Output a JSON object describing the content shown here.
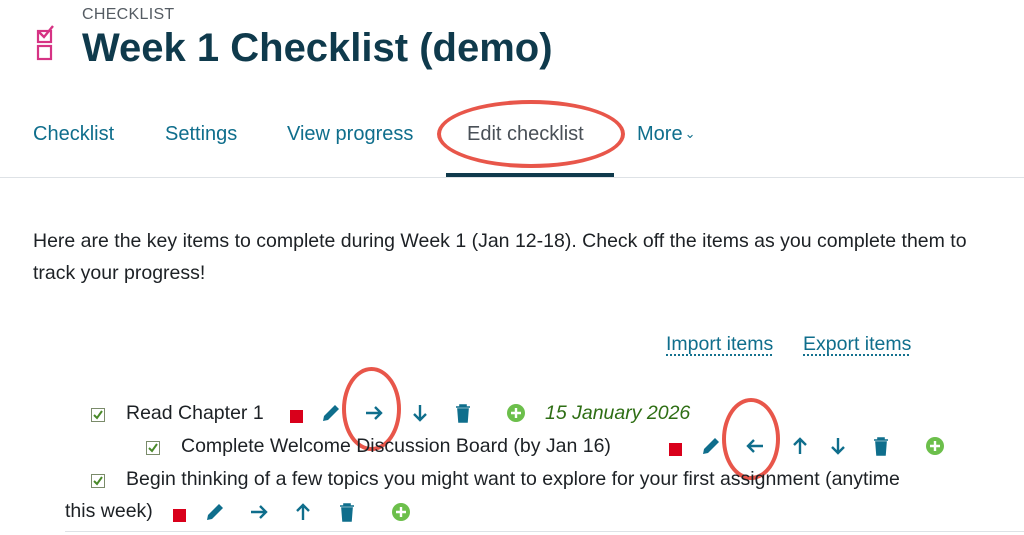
{
  "header": {
    "crumb": "CHECKLIST",
    "title": "Week 1 Checklist (demo)",
    "module_icon": "checklist-icon"
  },
  "tabs": [
    {
      "label": "Checklist"
    },
    {
      "label": "Settings"
    },
    {
      "label": "View progress"
    },
    {
      "label": "Edit checklist",
      "active": true
    },
    {
      "label": "More"
    }
  ],
  "intro": "Here are the key items to complete during Week 1 (Jan 12-18). Check off the items as you complete them to track your progress!",
  "actions": {
    "import": "Import items",
    "export": "Export items"
  },
  "items": [
    {
      "text": "Read Chapter 1",
      "indent": 0,
      "date": "15 January 2026"
    },
    {
      "text": "Complete Welcome Discussion Board (by Jan 16)",
      "indent": 1
    },
    {
      "text": "Begin thinking of a few topics you might want to explore for your first assignment (anytime",
      "text2": "this week)",
      "indent": 0
    }
  ],
  "colors": {
    "accent": "#0f6e8c",
    "title": "#0f3a4c",
    "required": "#d9001b",
    "add": "#6cbf4b",
    "highlight": "#e8564a",
    "date": "#2e6e14"
  }
}
